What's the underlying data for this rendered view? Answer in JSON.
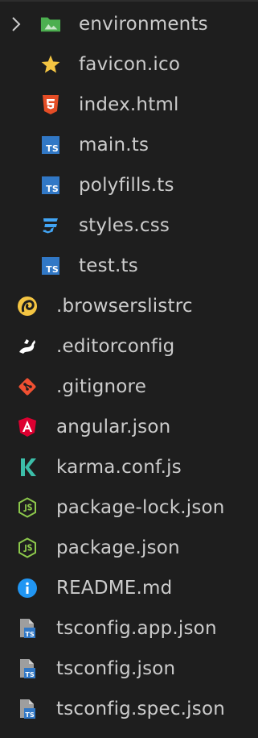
{
  "explorer": {
    "folder": {
      "label": "environments",
      "icon": "folder-icon",
      "expanded": false
    },
    "src_files": [
      {
        "label": "favicon.ico",
        "icon": "star-icon"
      },
      {
        "label": "index.html",
        "icon": "html5-icon"
      },
      {
        "label": "main.ts",
        "icon": "typescript-icon"
      },
      {
        "label": "polyfills.ts",
        "icon": "typescript-icon"
      },
      {
        "label": "styles.css",
        "icon": "css3-icon"
      },
      {
        "label": "test.ts",
        "icon": "typescript-icon"
      }
    ],
    "root_files": [
      {
        "label": ".browserslistrc",
        "icon": "browserslist-icon"
      },
      {
        "label": ".editorconfig",
        "icon": "editorconfig-icon"
      },
      {
        "label": ".gitignore",
        "icon": "git-icon"
      },
      {
        "label": "angular.json",
        "icon": "angular-icon"
      },
      {
        "label": "karma.conf.js",
        "icon": "karma-icon"
      },
      {
        "label": "package-lock.json",
        "icon": "nodejs-icon"
      },
      {
        "label": "package.json",
        "icon": "nodejs-icon"
      },
      {
        "label": "README.md",
        "icon": "info-icon"
      },
      {
        "label": "tsconfig.app.json",
        "icon": "tsconfig-icon"
      },
      {
        "label": "tsconfig.json",
        "icon": "tsconfig-icon"
      },
      {
        "label": "tsconfig.spec.json",
        "icon": "tsconfig-icon"
      }
    ]
  },
  "colors": {
    "background": "#1e1e1e",
    "text": "#cccccc",
    "folder": "#4caf50",
    "star": "#f4c542",
    "html": "#e44d26",
    "typescript": "#3178c6",
    "css": "#42a5f5",
    "git": "#f05032",
    "angular": "#dd0031",
    "karma": "#3cbea9",
    "node": "#8cc84b",
    "info": "#2196f3"
  }
}
